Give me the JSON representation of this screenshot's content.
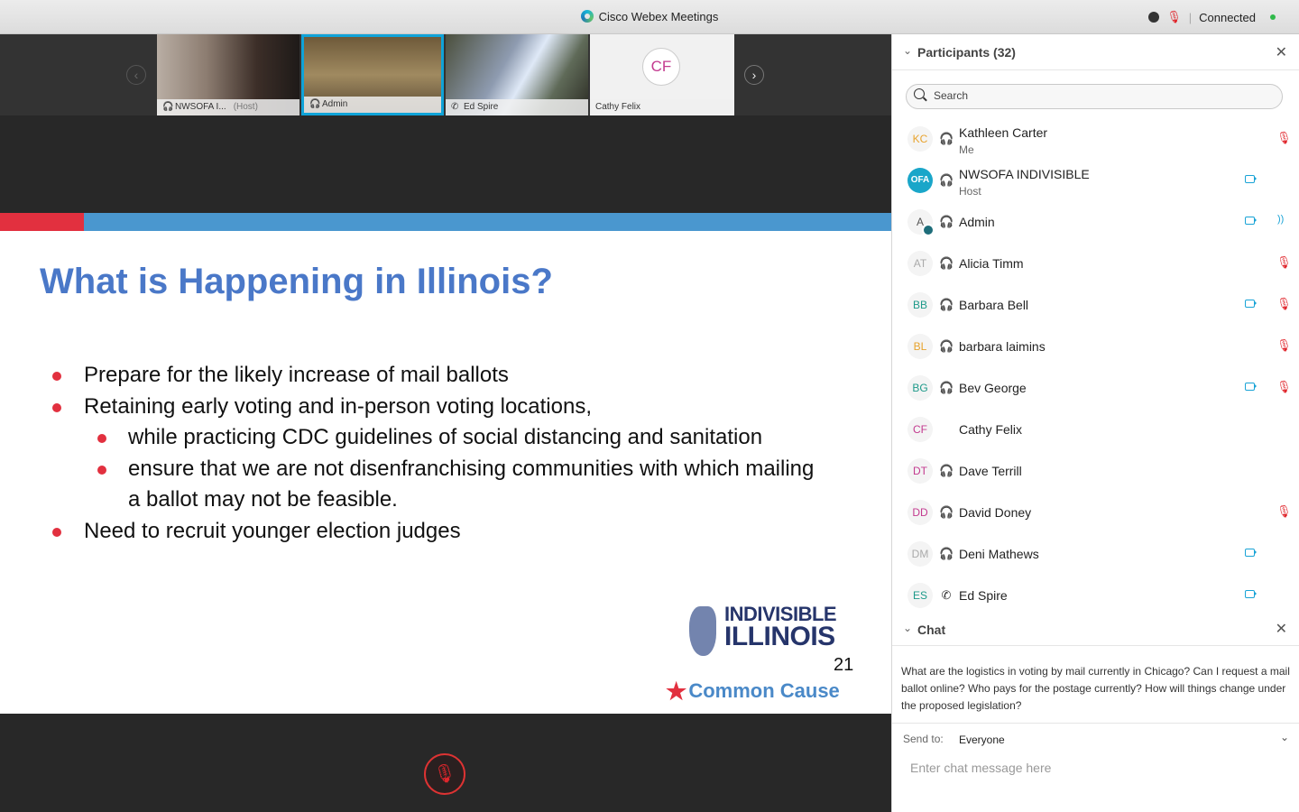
{
  "window": {
    "title": "Cisco Webex Meetings",
    "status": "Connected"
  },
  "thumbnails": [
    {
      "name": "NWSOFA I...",
      "role": "(Host)",
      "icon": "headset-icon"
    },
    {
      "name": "Admin",
      "role": "",
      "icon": "headset-icon"
    },
    {
      "name": "Ed Spire",
      "role": "",
      "icon": "phone-icon"
    },
    {
      "name": "Cathy Felix",
      "role": "",
      "initials": "CF"
    }
  ],
  "slide": {
    "title": "What is Happening in Illinois?",
    "bullets": [
      "Prepare for the likely increase of mail ballots",
      "Retaining early voting and in-person voting locations,",
      "while practicing CDC guidelines of social distancing and sanitation",
      "ensure that we are not disenfranchising communities with which mailing",
      "a ballot may not be feasible.",
      "Need to recruit younger election judges"
    ],
    "brand_line1": "INDIVISIBLE",
    "brand_line2": "ILLINOIS",
    "page_number": "21",
    "brand_cc": "Common Cause"
  },
  "participants": {
    "header": "Participants (32)",
    "search_placeholder": "Search",
    "list": [
      {
        "initials": "KC",
        "color": "#e8a32e",
        "name": "Kathleen Carter",
        "sub": "Me",
        "icon": "headset",
        "video": false,
        "mic": "muted"
      },
      {
        "initials": "OFA",
        "color": "#ffffff",
        "name": "NWSOFA INDIVISIBLE",
        "sub": "Host",
        "icon": "headset",
        "video": true,
        "mic": "none"
      },
      {
        "initials": "A",
        "color": "#555555",
        "name": "Admin",
        "sub": "",
        "icon": "headset",
        "video": true,
        "mic": "audio"
      },
      {
        "initials": "AT",
        "color": "#aaaaaa",
        "name": "Alicia Timm",
        "sub": "",
        "icon": "headset",
        "video": false,
        "mic": "muted"
      },
      {
        "initials": "BB",
        "color": "#1e9a8a",
        "name": "Barbara Bell",
        "sub": "",
        "icon": "headset",
        "video": true,
        "mic": "muted"
      },
      {
        "initials": "BL",
        "color": "#e8a32e",
        "name": "barbara laimins",
        "sub": "",
        "icon": "headset",
        "video": false,
        "mic": "muted"
      },
      {
        "initials": "BG",
        "color": "#1e9a8a",
        "name": "Bev George",
        "sub": "",
        "icon": "headset",
        "video": true,
        "mic": "muted"
      },
      {
        "initials": "CF",
        "color": "#c33a8f",
        "name": "Cathy Felix",
        "sub": "",
        "icon": "none",
        "video": false,
        "mic": "none"
      },
      {
        "initials": "DT",
        "color": "#c33a8f",
        "name": "Dave Terrill",
        "sub": "",
        "icon": "headset",
        "video": false,
        "mic": "none"
      },
      {
        "initials": "DD",
        "color": "#c33a8f",
        "name": "David Doney",
        "sub": "",
        "icon": "headset",
        "video": false,
        "mic": "muted"
      },
      {
        "initials": "DM",
        "color": "#aaaaaa",
        "name": "Deni Mathews",
        "sub": "",
        "icon": "headset",
        "video": true,
        "mic": "none"
      },
      {
        "initials": "ES",
        "color": "#1e9a8a",
        "name": "Ed Spire",
        "sub": "",
        "icon": "phone",
        "video": true,
        "mic": "none"
      }
    ]
  },
  "chat": {
    "header": "Chat",
    "message": "What are the logistics in voting by mail currently in Chicago?  Can I request a mail ballot online?  Who pays for the postage currently?  How will things change under the proposed legislation?",
    "send_to_label": "Send to:",
    "send_to_value": "Everyone",
    "input_placeholder": "Enter chat message here"
  }
}
